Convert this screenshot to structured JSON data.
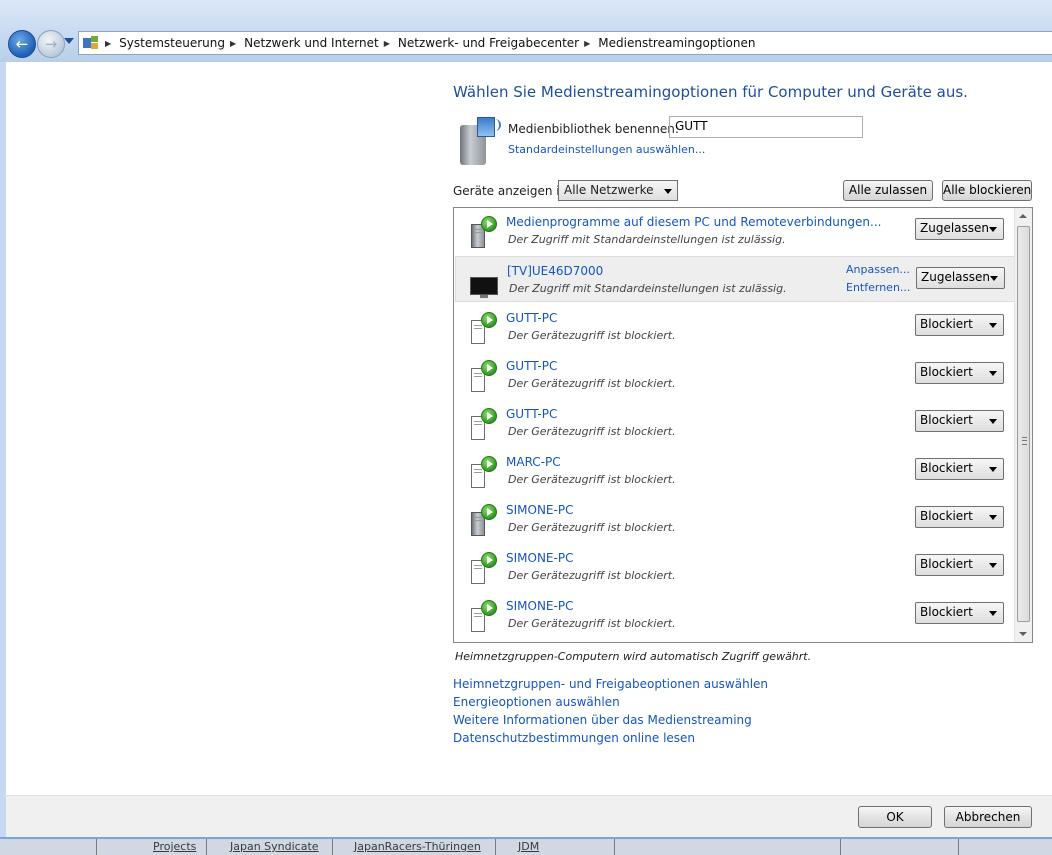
{
  "breadcrumb": [
    "Systemsteuerung",
    "Netzwerk und Internet",
    "Netzwerk- und Freigabecenter",
    "Medienstreamingoptionen"
  ],
  "page_title": "Wählen Sie Medienstreamingoptionen für Computer und Geräte aus.",
  "library": {
    "label": "Medienbibliothek benennen:",
    "value": "GUTT",
    "defaults_link": "Standardeinstellungen auswählen..."
  },
  "filter": {
    "label": "Geräte anzeigen in:",
    "selected": "Alle Netzwerke",
    "allow_all": "Alle zulassen",
    "block_all": "Alle blockieren"
  },
  "devices": [
    {
      "name": "Medienprogramme auf diesem PC und Remoteverbindungen...",
      "status": "Der Zugriff mit Standardeinstellungen ist zulässig.",
      "access": "Zugelassen",
      "icon": "pc-tower-dark-icon"
    },
    {
      "name": "[TV]UE46D7000",
      "status": "Der Zugriff mit Standardeinstellungen ist zulässig.",
      "access": "Zugelassen",
      "icon": "tv-icon",
      "action1": "Anpassen...",
      "action2": "Entfernen..."
    },
    {
      "name": "GUTT-PC",
      "status": "Der Gerätezugriff ist blockiert.",
      "access": "Blockiert",
      "icon": "pc-tower-icon"
    },
    {
      "name": "GUTT-PC",
      "status": "Der Gerätezugriff ist blockiert.",
      "access": "Blockiert",
      "icon": "pc-tower-icon"
    },
    {
      "name": "GUTT-PC",
      "status": "Der Gerätezugriff ist blockiert.",
      "access": "Blockiert",
      "icon": "pc-tower-icon"
    },
    {
      "name": "MARC-PC",
      "status": "Der Gerätezugriff ist blockiert.",
      "access": "Blockiert",
      "icon": "pc-tower-icon"
    },
    {
      "name": "SIMONE-PC",
      "status": "Der Gerätezugriff ist blockiert.",
      "access": "Blockiert",
      "icon": "pc-tower-dark-icon"
    },
    {
      "name": "SIMONE-PC",
      "status": "Der Gerätezugriff ist blockiert.",
      "access": "Blockiert",
      "icon": "pc-tower-icon"
    },
    {
      "name": "SIMONE-PC",
      "status": "Der Gerätezugriff ist blockiert.",
      "access": "Blockiert",
      "icon": "pc-tower-icon"
    }
  ],
  "homegroup_note": "Heimnetzgruppen-Computern wird automatisch Zugriff gewährt.",
  "links": [
    "Heimnetzgruppen- und Freigabeoptionen auswählen",
    "Energieoptionen auswählen",
    "Weitere Informationen über das Medienstreaming",
    "Datenschutzbestimmungen online lesen"
  ],
  "buttons": {
    "ok": "OK",
    "cancel": "Abbrechen"
  },
  "taskbar": [
    "Projects",
    "Japan Syndicate",
    "JapanRacers-Thüringen",
    "JDM"
  ]
}
